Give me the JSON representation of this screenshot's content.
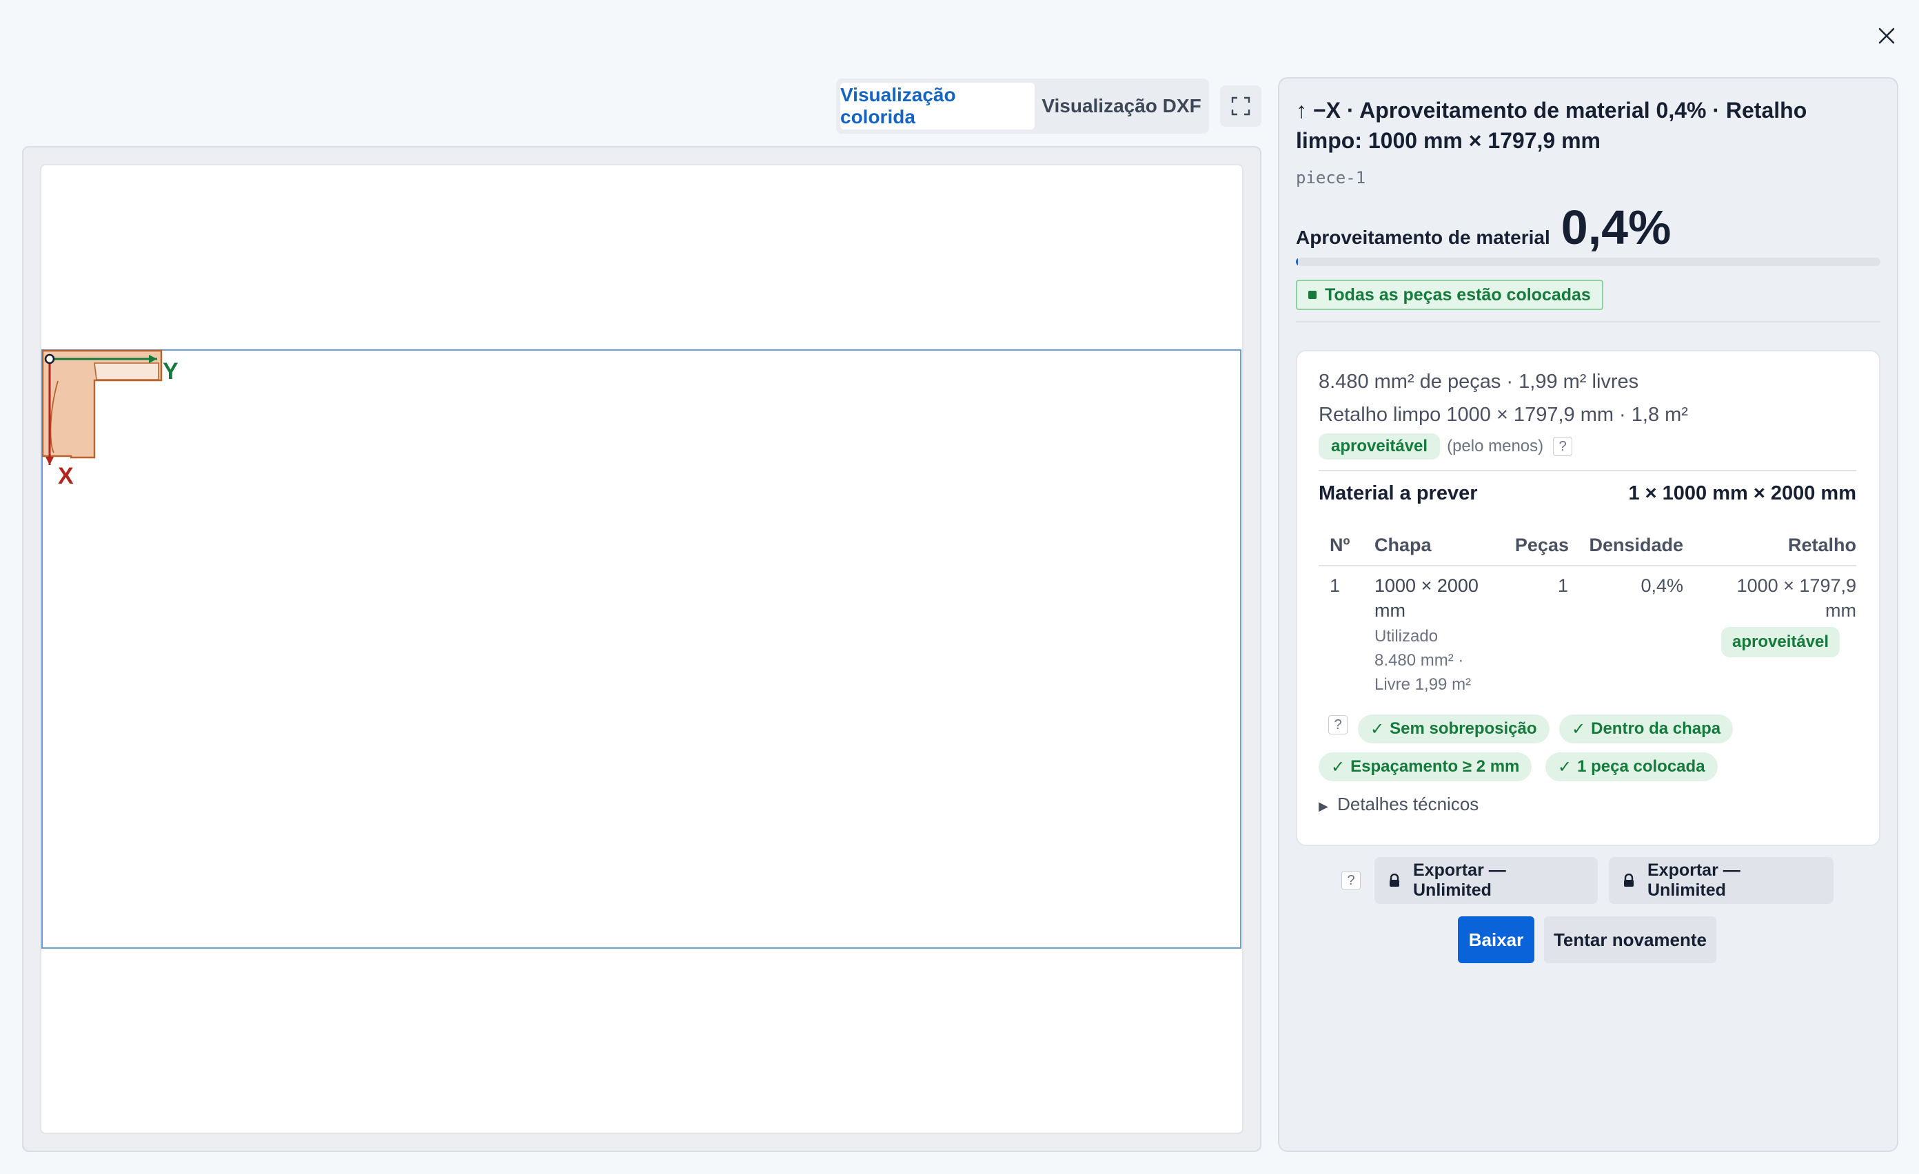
{
  "dialog": {
    "close_icon": "close-icon"
  },
  "view_tabs": {
    "colored": "Visualização colorida",
    "dxf": "Visualização DXF",
    "fullscreen_icon": "expand-icon"
  },
  "canvas": {
    "axis_x": "X",
    "axis_y": "Y",
    "piece_color": "#e8a97a",
    "sheet_outline_color": "#6e9dd4"
  },
  "panel": {
    "title": "↑ −X · Aproveitamento de material 0,4% · Retalho limpo: 1000 mm × 1797,9 mm",
    "piece_id": "piece-1",
    "efficiency_label": "Aproveitamento de material",
    "efficiency_value": "0,4%",
    "efficiency_fraction": 0.004,
    "placed_badge": "Todas as peças estão colocadas"
  },
  "stats": {
    "line1": "8.480 mm² de peças · 1,99 m² livres",
    "line2": "Retalho limpo 1000 × 1797,9 mm · 1,8 m²",
    "reusable_badge": "aproveitável",
    "reusable_note": "(pelo menos)",
    "help": "?",
    "material_label": "Material a prever",
    "material_value": "1 × 1000 mm × 2000 mm"
  },
  "table": {
    "headers": [
      "Nº",
      "Chapa",
      "Peças",
      "Densidade",
      "Retalho"
    ],
    "row": {
      "no": "1",
      "sheet_line1": "1000 × 2000",
      "sheet_line2": "mm",
      "used_line1": "Utilizado",
      "used_line2": "8.480 mm² ·",
      "used_line3": "Livre 1,99 m²",
      "pieces": "1",
      "density": "0,4%",
      "offcut_line1": "1000 × 1797,9",
      "offcut_line2": "mm",
      "offcut_badge": "aproveitável"
    }
  },
  "checks": {
    "no_overlap": "Sem sobreposição",
    "within_sheet": "Dentro da chapa",
    "spacing": "Espaçamento ≥ 2 mm",
    "placed": "1 peça colocada"
  },
  "details_label": "Detalhes técnicos",
  "export": {
    "label_a": "Exportar — Unlimited",
    "label_b": "Exportar — Unlimited",
    "help": "?"
  },
  "actions": {
    "download": "Baixar",
    "retry": "Tentar novamente"
  }
}
